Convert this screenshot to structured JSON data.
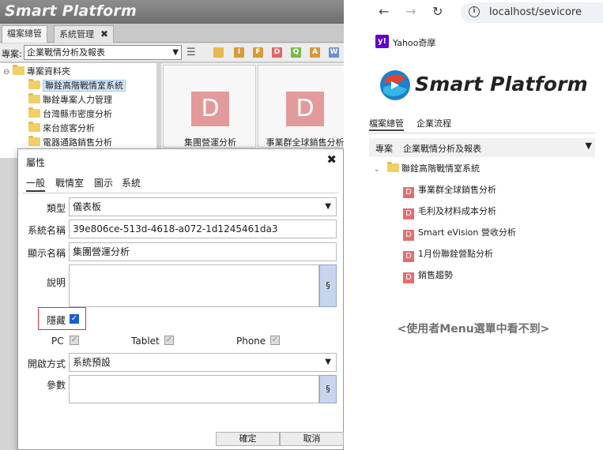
{
  "app": {
    "title": "Smart Platform",
    "tabs": [
      {
        "label": "檔案總管"
      },
      {
        "label": "系統管理",
        "close": "✖"
      }
    ],
    "toolbar": {
      "project_label": "專案:",
      "project_value": "企業戰情分析及報表",
      "list_icon": "☰",
      "icons": [
        {
          "name": "folder-add-icon",
          "text": "",
          "color": "#e8b84a"
        },
        {
          "name": "i-icon",
          "text": "I",
          "color": "#d79a3a"
        },
        {
          "name": "f-icon",
          "text": "F",
          "color": "#d79a3a"
        },
        {
          "name": "d-icon",
          "text": "D",
          "color": "#d66"
        },
        {
          "name": "q-icon",
          "text": "Q",
          "color": "#7bb94c"
        },
        {
          "name": "a-icon",
          "text": "A",
          "color": "#d79a3a"
        },
        {
          "name": "w-icon",
          "text": "W",
          "color": "#6a8fd0"
        }
      ]
    },
    "tree": {
      "root": "專案資料夾",
      "items": [
        "聯銓高階戰情室系統",
        "聯銓專案人力管理",
        "台灣縣市密度分析",
        "來台旅客分析",
        "電器通路銷售分析"
      ]
    },
    "cards": [
      {
        "icon": "D",
        "label": "集團營運分析"
      },
      {
        "icon": "D",
        "label": "事業群全球銷售分析"
      }
    ],
    "dialog": {
      "title": "屬性",
      "close": "✖",
      "tabs": [
        "一般",
        "戰情室",
        "圖示",
        "系統"
      ],
      "fields": {
        "type_label": "類型",
        "type_value": "儀表板",
        "sysname_label": "系統名稱",
        "sysname_value": "39e806ce-513d-4618-a072-1d1245461da3",
        "display_label": "顯示名稱",
        "display_value": "集團營運分析",
        "desc_label": "說明",
        "hide_label": "隱藏",
        "hide_checked": true,
        "devices": [
          "PC",
          "Tablet",
          "Phone"
        ],
        "open_label": "開啟方式",
        "open_value": "系統預設",
        "param_label": "參數"
      },
      "ok_label": "確定",
      "cancel_label": "取消"
    }
  },
  "browser": {
    "url": "localhost/sevicore",
    "bookmark_icon": "y!",
    "bookmark_label": "Yahoo奇摩",
    "brand": "Smart Platform",
    "tabs": [
      "檔案總管",
      "企業流程"
    ],
    "project_label": "專案",
    "project_value": "企業戰情分析及報表",
    "folder": "聯銓高階戰情室系統",
    "items": [
      "事業群全球銷售分析",
      "毛利及材料成本分析",
      "Smart eVision 營收分析",
      "1月份聯銓營點分析",
      "銷售趨勢"
    ],
    "item_icon": "D",
    "note": "<使用者Menu選單中看不到>"
  }
}
